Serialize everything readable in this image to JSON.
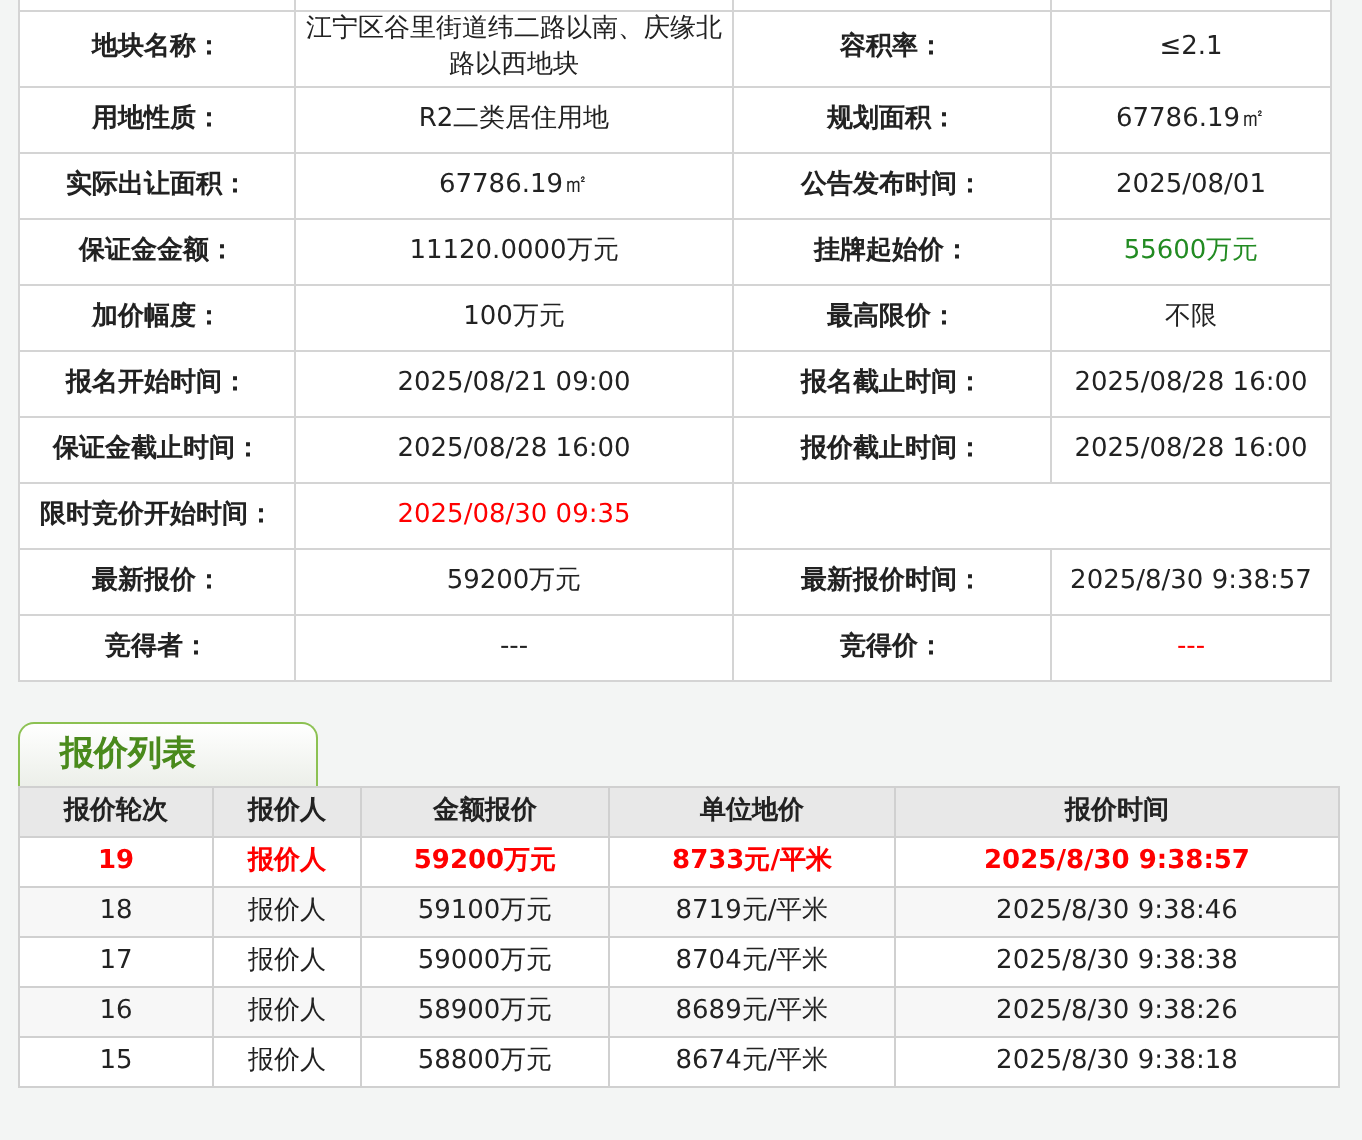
{
  "info": {
    "rows": [
      {
        "pairs": [
          {
            "label": "地块名称：",
            "value": "江宁区谷里街道纬二路以南、庆缘北路以西地块"
          },
          {
            "label": "容积率：",
            "value": "≤2.1"
          }
        ]
      },
      {
        "pairs": [
          {
            "label": "用地性质：",
            "value": "R2二类居住用地"
          },
          {
            "label": "规划面积：",
            "value": "67786.19㎡"
          }
        ]
      },
      {
        "pairs": [
          {
            "label": "实际出让面积：",
            "value": "67786.19㎡"
          },
          {
            "label": "公告发布时间：",
            "value": "2025/08/01"
          }
        ]
      },
      {
        "pairs": [
          {
            "label": "保证金金额：",
            "value": "11120.0000万元"
          },
          {
            "label": "挂牌起始价：",
            "value": "55600万元",
            "color": "#228b22"
          }
        ]
      },
      {
        "pairs": [
          {
            "label": "加价幅度：",
            "value": "100万元"
          },
          {
            "label": "最高限价：",
            "value": "不限"
          }
        ]
      },
      {
        "pairs": [
          {
            "label": "报名开始时间：",
            "value": "2025/08/21 09:00"
          },
          {
            "label": "报名截止时间：",
            "value": "2025/08/28 16:00"
          }
        ]
      },
      {
        "pairs": [
          {
            "label": "保证金截止时间：",
            "value": "2025/08/28 16:00"
          },
          {
            "label": "报价截止时间：",
            "value": "2025/08/28 16:00"
          }
        ]
      },
      {
        "pairs": [
          {
            "label": "限时竞价开始时间：",
            "value": "2025/08/30 09:35",
            "color": "#ff0000"
          }
        ]
      },
      {
        "pairs": [
          {
            "label": "最新报价：",
            "value": "59200万元"
          },
          {
            "label": "最新报价时间：",
            "value": "2025/8/30 9:38:57"
          }
        ]
      },
      {
        "pairs": [
          {
            "label": "竞得者：",
            "value": "---"
          },
          {
            "label": "竞得价：",
            "value": "---",
            "color": "#ff0000"
          }
        ]
      }
    ]
  },
  "bids": {
    "tab": "报价列表",
    "columns": [
      "报价轮次",
      "报价人",
      "金额报价",
      "单位地价",
      "报价时间"
    ],
    "rows": [
      {
        "latest": true,
        "cells": [
          "19",
          "报价人",
          "59200万元",
          "8733元/平米",
          "2025/8/30 9:38:57"
        ]
      },
      {
        "latest": false,
        "cells": [
          "18",
          "报价人",
          "59100万元",
          "8719元/平米",
          "2025/8/30 9:38:46"
        ]
      },
      {
        "latest": false,
        "cells": [
          "17",
          "报价人",
          "59000万元",
          "8704元/平米",
          "2025/8/30 9:38:38"
        ]
      },
      {
        "latest": false,
        "cells": [
          "16",
          "报价人",
          "58900万元",
          "8689元/平米",
          "2025/8/30 9:38:26"
        ]
      },
      {
        "latest": false,
        "cells": [
          "15",
          "报价人",
          "58800万元",
          "8674元/平米",
          "2025/8/30 9:38:18"
        ]
      }
    ]
  }
}
